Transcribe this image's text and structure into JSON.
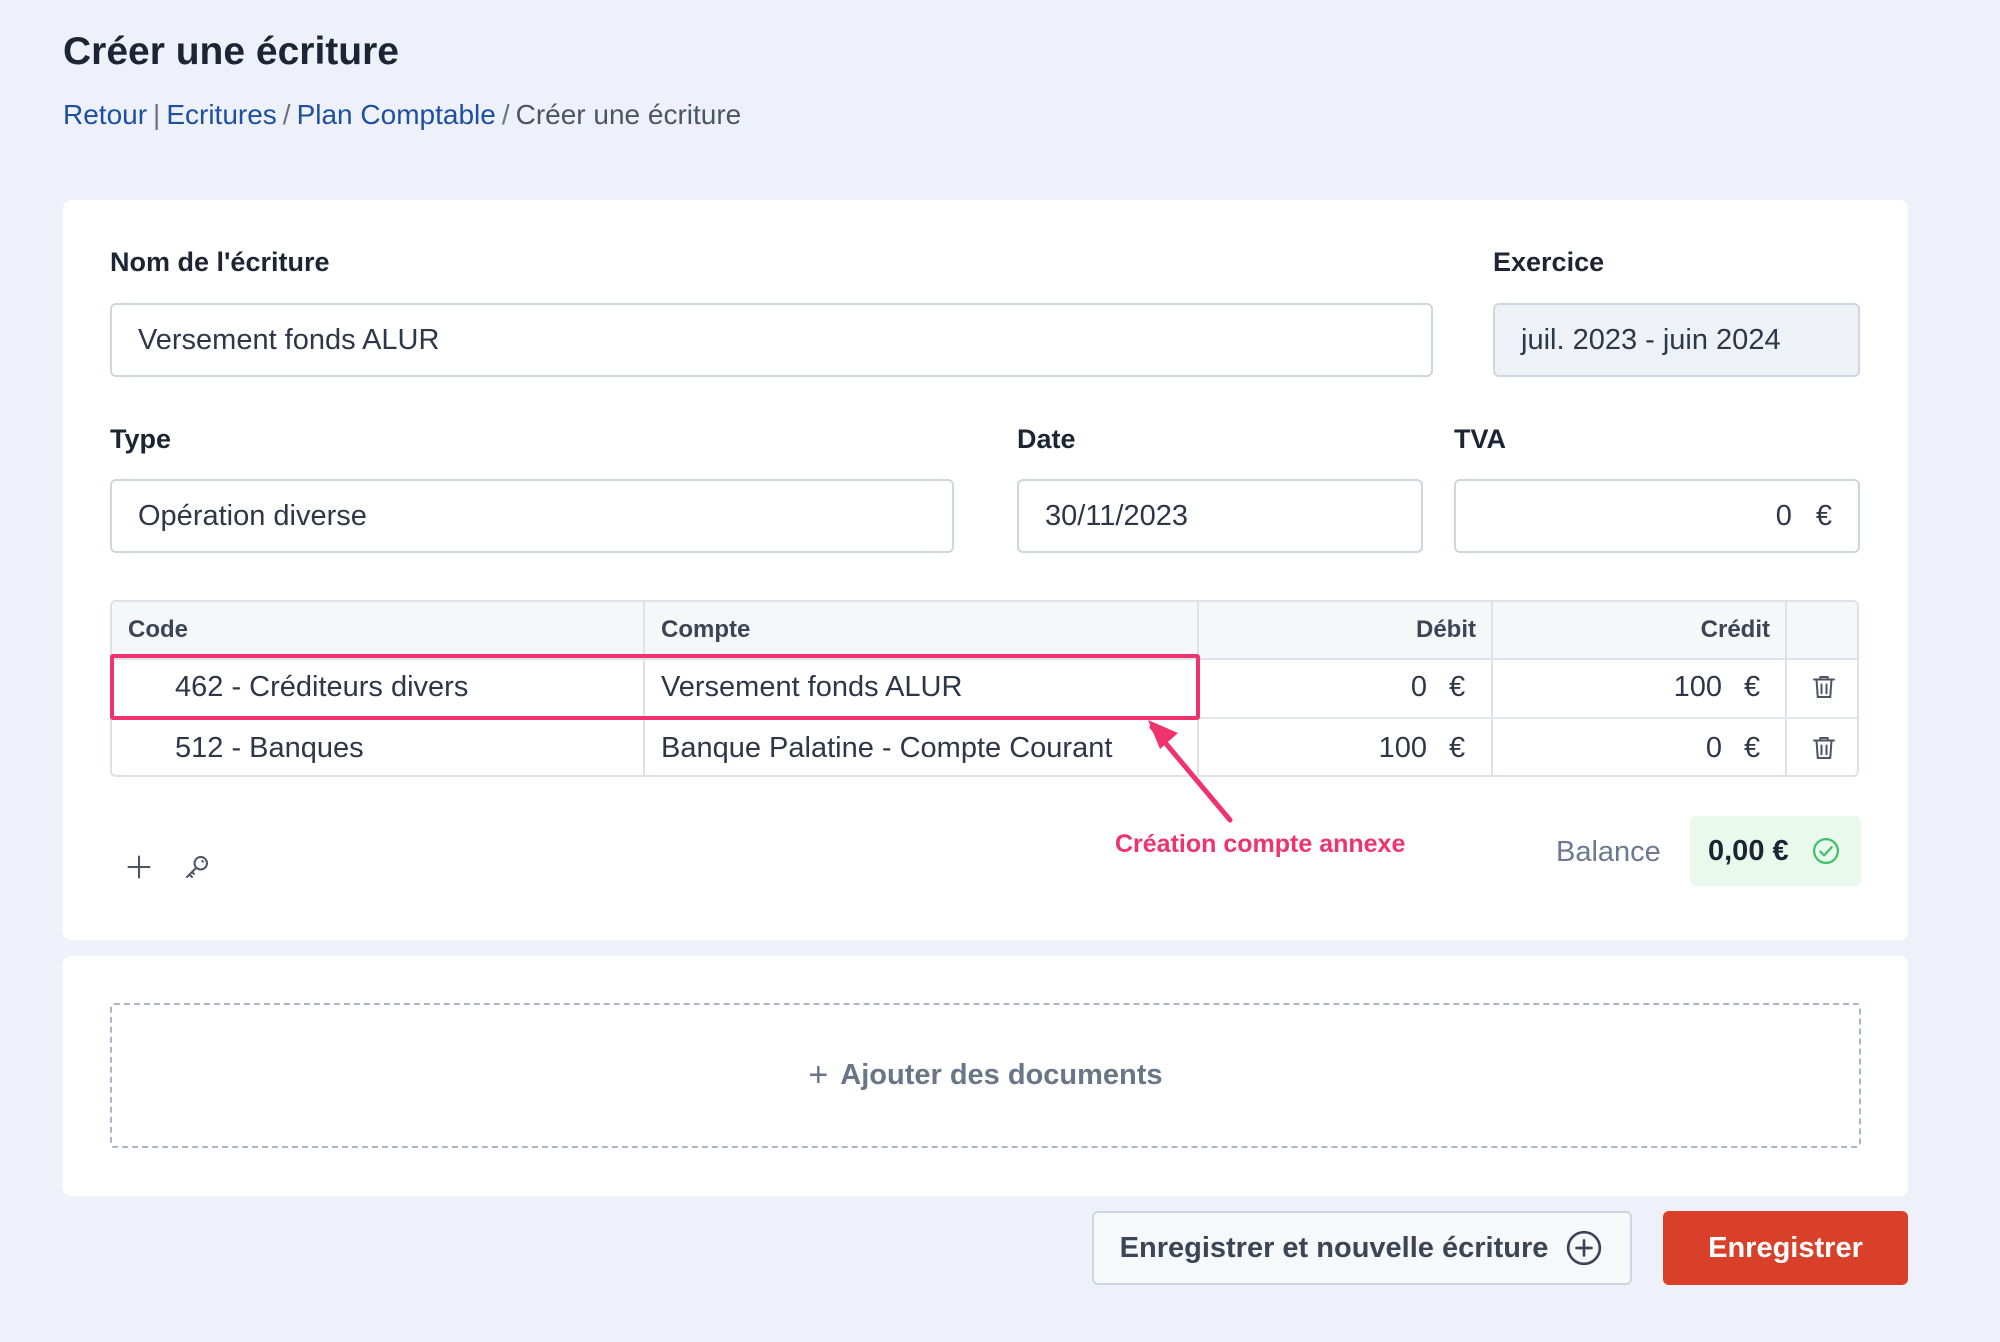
{
  "page_title": "Créer une écriture",
  "breadcrumb": {
    "back": "Retour",
    "sep1": "|",
    "crumb1": "Ecritures",
    "sep2": "/",
    "crumb2": "Plan Comptable",
    "sep3": "/",
    "current": "Créer une écriture"
  },
  "form": {
    "name_label": "Nom de l'écriture",
    "name_value": "Versement fonds ALUR",
    "exercice_label": "Exercice",
    "exercice_value": "juil. 2023 - juin 2024",
    "type_label": "Type",
    "type_value": "Opération diverse",
    "date_label": "Date",
    "date_value": "30/11/2023",
    "tva_label": "TVA",
    "tva_value": "0",
    "currency": "€"
  },
  "table": {
    "headers": {
      "code": "Code",
      "compte": "Compte",
      "debit": "Débit",
      "credit": "Crédit"
    },
    "rows": [
      {
        "code": "462 - Créditeurs divers",
        "compte": "Versement fonds ALUR",
        "debit": "0",
        "credit": "100"
      },
      {
        "code": "512 - Banques",
        "compte": "Banque Palatine - Compte Courant",
        "debit": "100",
        "credit": "0"
      }
    ]
  },
  "annotation": "Création compte annexe",
  "balance": {
    "label": "Balance",
    "value": "0,00 €"
  },
  "documents": {
    "add_label": "Ajouter des documents",
    "plus": "+"
  },
  "actions": {
    "save_and_new": "Enregistrer et nouvelle écriture",
    "save": "Enregistrer"
  },
  "colors": {
    "link": "#1e4fa3",
    "annotation": "#f0326e",
    "primary": "#d9402a",
    "balance_ok_bg": "#e9f9ec",
    "balance_ok_icon": "#3cc26b"
  },
  "icons": [
    "plus-icon",
    "key-icon",
    "trash-icon",
    "check-circle-icon",
    "plus-circle-icon"
  ]
}
